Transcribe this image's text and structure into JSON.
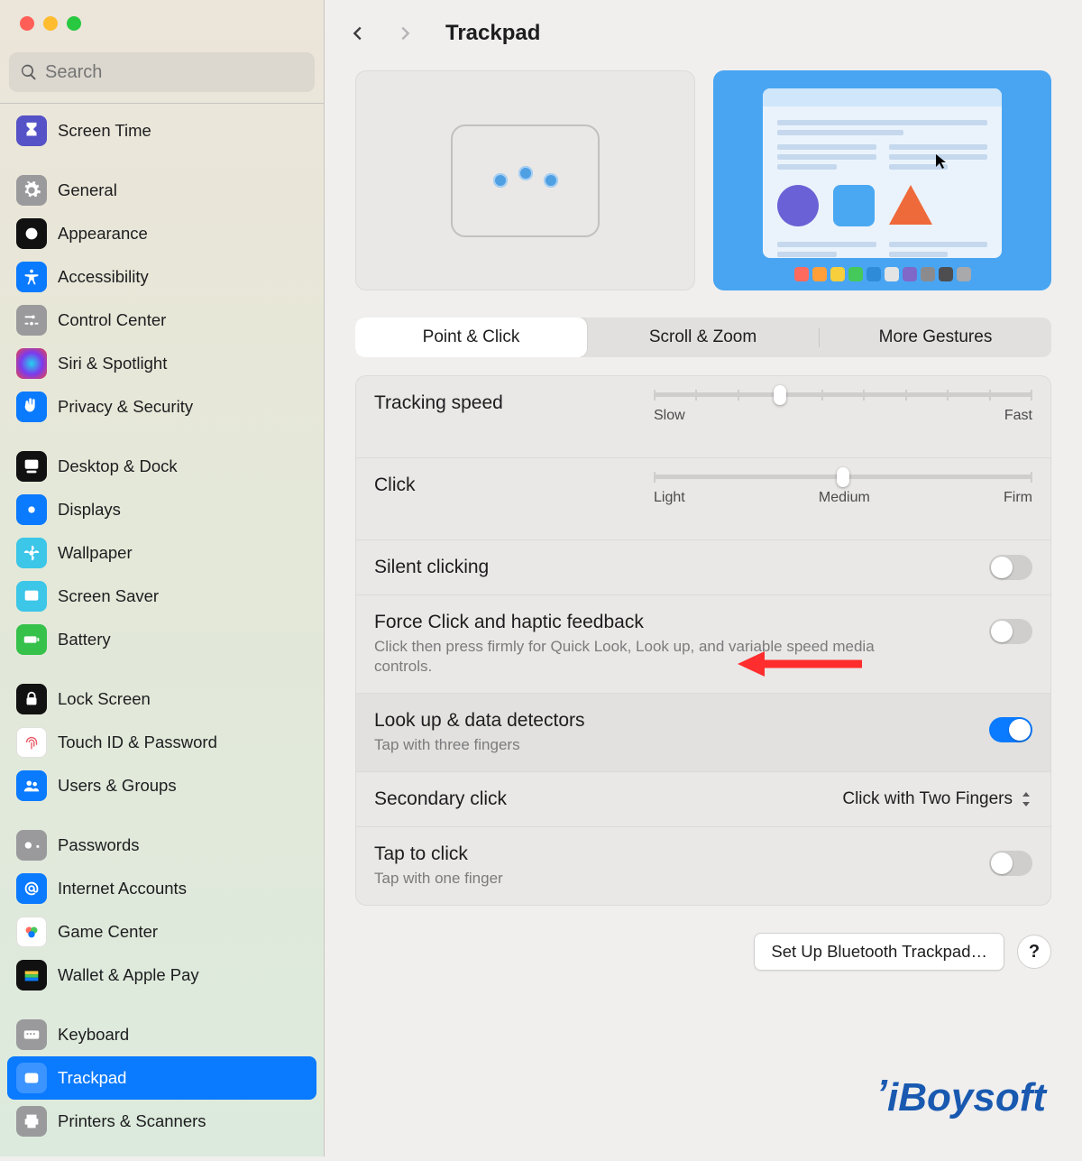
{
  "header": {
    "title": "Trackpad"
  },
  "search": {
    "placeholder": "Search"
  },
  "sidebar": {
    "items": [
      {
        "label": "Screen Time"
      },
      {
        "label": "General"
      },
      {
        "label": "Appearance"
      },
      {
        "label": "Accessibility"
      },
      {
        "label": "Control Center"
      },
      {
        "label": "Siri & Spotlight"
      },
      {
        "label": "Privacy & Security"
      },
      {
        "label": "Desktop & Dock"
      },
      {
        "label": "Displays"
      },
      {
        "label": "Wallpaper"
      },
      {
        "label": "Screen Saver"
      },
      {
        "label": "Battery"
      },
      {
        "label": "Lock Screen"
      },
      {
        "label": "Touch ID & Password"
      },
      {
        "label": "Users & Groups"
      },
      {
        "label": "Passwords"
      },
      {
        "label": "Internet Accounts"
      },
      {
        "label": "Game Center"
      },
      {
        "label": "Wallet & Apple Pay"
      },
      {
        "label": "Keyboard"
      },
      {
        "label": "Trackpad"
      },
      {
        "label": "Printers & Scanners"
      }
    ]
  },
  "tabs": [
    {
      "label": "Point & Click",
      "active": true
    },
    {
      "label": "Scroll & Zoom",
      "active": false
    },
    {
      "label": "More Gestures",
      "active": false
    }
  ],
  "tracking": {
    "title": "Tracking speed",
    "min_label": "Slow",
    "max_label": "Fast",
    "ticks": 10,
    "value_index": 3
  },
  "click": {
    "title": "Click",
    "left_label": "Light",
    "mid_label": "Medium",
    "right_label": "Firm",
    "ticks": 3,
    "value_index": 1
  },
  "silent": {
    "title": "Silent clicking",
    "on": false
  },
  "force": {
    "title": "Force Click and haptic feedback",
    "desc": "Click then press firmly for Quick Look, Look up, and variable speed media controls.",
    "on": false
  },
  "lookup": {
    "title": "Look up & data detectors",
    "desc": "Tap with three fingers",
    "on": true
  },
  "secondary": {
    "title": "Secondary click",
    "value": "Click with Two Fingers"
  },
  "tap": {
    "title": "Tap to click",
    "desc": "Tap with one finger",
    "on": false
  },
  "bottom": {
    "setup": "Set Up Bluetooth Trackpad…",
    "help": "?"
  },
  "watermark": "iBoysoft",
  "dock_colors": [
    "#ff6a5f",
    "#ff9f3a",
    "#f7cf3c",
    "#45c95a",
    "#2e8bd7",
    "#e4e4e4",
    "#7f68c8",
    "#8b8b8d",
    "#4e4e50",
    "#a9a9ab"
  ]
}
